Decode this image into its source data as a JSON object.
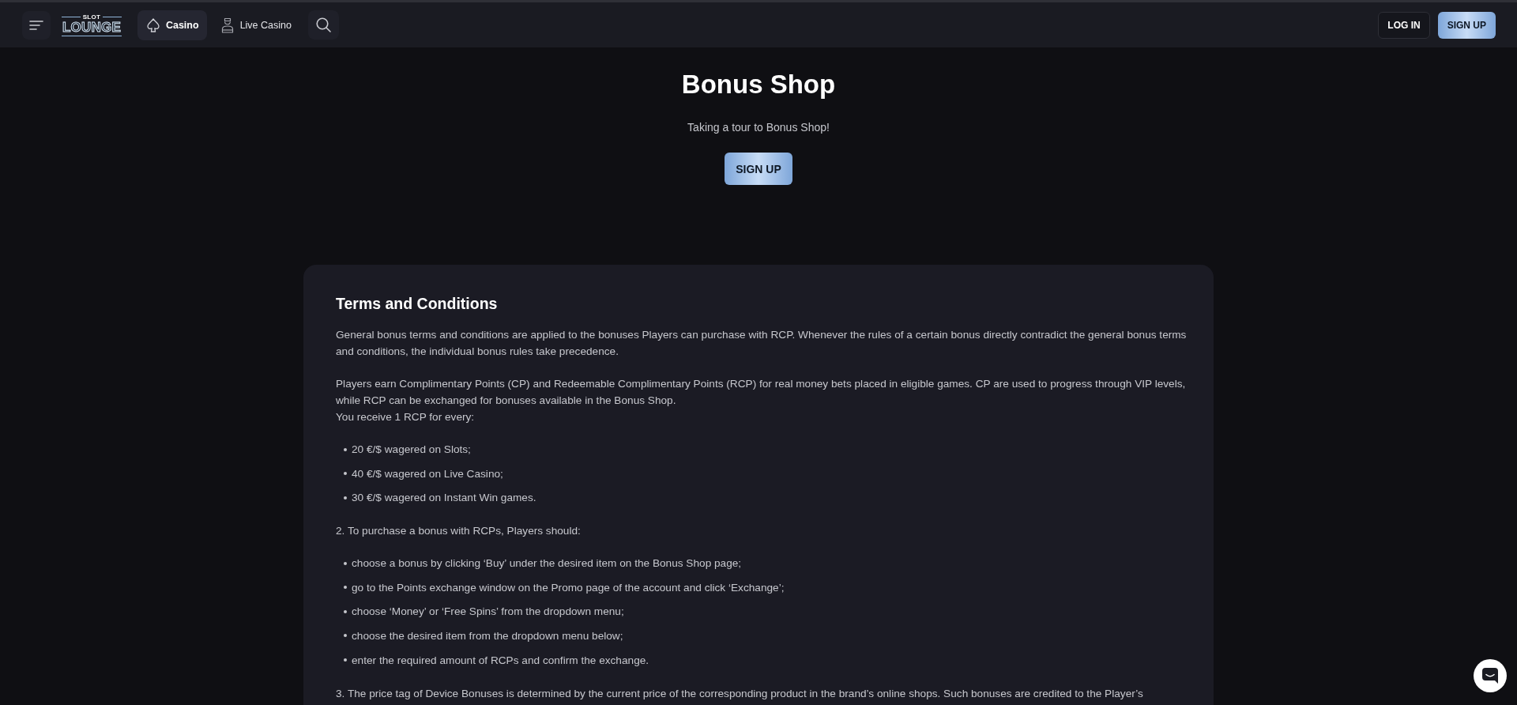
{
  "header": {
    "logo": {
      "top": "SLOT",
      "main": "LOUNGE"
    },
    "tabs": [
      {
        "label": "Casino",
        "kind": "casino",
        "selected": true
      },
      {
        "label": "Live Casino",
        "kind": "live_casino",
        "selected": false
      }
    ],
    "buttons": [
      {
        "label": "LOG IN",
        "kind": "outline"
      },
      {
        "label": "SIGN UP",
        "kind": "primary"
      }
    ]
  },
  "hero": {
    "title": "Bonus Shop",
    "subtitle": "Taking a tour to Bonus Shop!",
    "button": {
      "label": "SIGN UP",
      "kind": "primary"
    }
  },
  "terms": {
    "title": "Terms and Conditions",
    "blocks": [
      {
        "kind": "paragraph",
        "lines": [
          "General bonus terms and conditions are applied to the bonuses Players can purchase with RCP. Whenever the rules of a certain bonus directly contradict the general bonus terms and conditions, the individual bonus rules take precedence."
        ]
      },
      {
        "kind": "paragraph",
        "lines": [
          "Players earn Complimentary Points (CP) and Redeemable Complimentary Points (RCP) for real money bets placed in eligible games. CP are used to progress through VIP levels, while RCP can be exchanged for bonuses available in the Bonus Shop.",
          "You receive 1 RCP for every:"
        ]
      },
      {
        "kind": "list",
        "items": [
          "20 €/$ wagered on Slots;",
          "40 €/$ wagered on Live Casino;",
          "30 €/$ wagered on Instant Win games."
        ]
      },
      {
        "kind": "paragraph",
        "lines": [
          "2. To purchase a bonus with RCPs, Players should:"
        ]
      },
      {
        "kind": "list",
        "items": [
          "choose a bonus by clicking ‘Buy’ under the desired item on the Bonus Shop page;",
          "go to the Points exchange window on the Promo page of the account and click ‘Exchange’;",
          "choose ‘Money’ or ‘Free Spins’ from the dropdown menu;",
          "choose the desired item from the dropdown menu below;",
          "enter the required amount of RCPs and confirm the exchange."
        ]
      },
      {
        "kind": "paragraph",
        "lines": [
          "3. The price tag of Device Bonuses is determined by the current price of the corresponding product in the brand’s online shops. Such bonuses are credited to the Player’s"
        ]
      }
    ]
  }
}
